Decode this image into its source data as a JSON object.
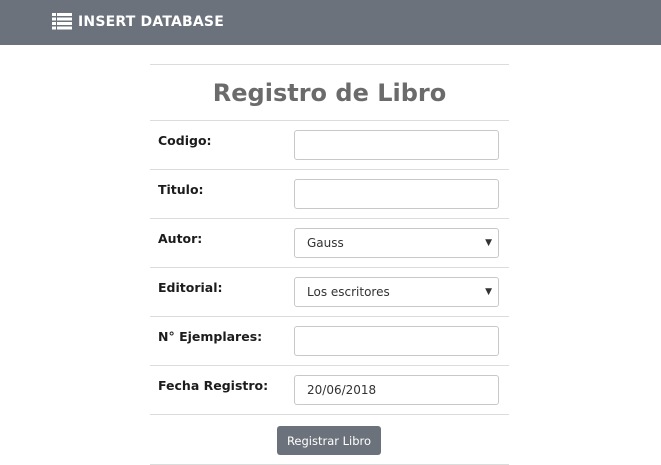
{
  "navbar": {
    "brand_text": "INSERT DATABASE",
    "brand_icon": "list-icon",
    "background": "#6b727b"
  },
  "form": {
    "title": "Registro de Libro",
    "fields": [
      {
        "label": "Codigo:",
        "type": "text",
        "value": ""
      },
      {
        "label": "Titulo:",
        "type": "text",
        "value": ""
      },
      {
        "label": "Autor:",
        "type": "select",
        "value": "Gauss"
      },
      {
        "label": "Editorial:",
        "type": "select",
        "value": "Los escritores"
      },
      {
        "label": "N° Ejemplares:",
        "type": "text",
        "value": ""
      },
      {
        "label": "Fecha Registro:",
        "type": "date",
        "value": "20/06/2018"
      }
    ],
    "submit_label": "Registrar Libro",
    "button_color": "#6b727b"
  }
}
